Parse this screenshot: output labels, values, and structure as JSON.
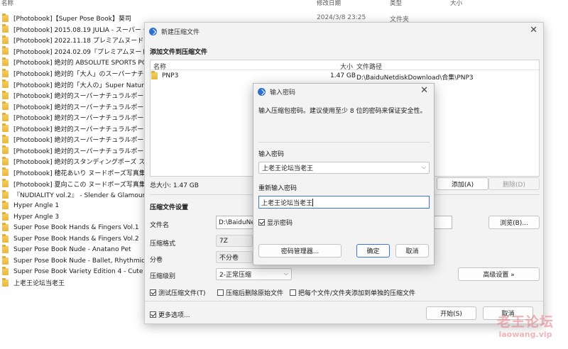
{
  "explorer": {
    "columns": {
      "name": "名称",
      "modified": "修改日期",
      "type": "类型",
      "size": "大小"
    },
    "first_row_date": "2024/3/8 23:25",
    "first_row_type": "文件夹",
    "items": [
      "[Photobook]【Super Pose Book】葵司",
      "[Photobook] 2015.08.19 JULIA - スーパー・ポ",
      "[Photobook] 2022.11.18 プレミアムヌードポー",
      "[Photobook] 2024.02.09『プレミアムヌードポ",
      "[Photobook] 絶対的 ABSOLUTE SPORTS POSES",
      "[Photobook] 絶対的「大人」のスーパーナチュ",
      "[Photobook] 絶対的「大人の」Super Natural P",
      "[Photobook] 絶対的スーパーナチュラルポーズ",
      "[Photobook] 絶対的スーパーナチュラルポーズ",
      "[Photobook] 絶対的スーパーナチュラルポーズ",
      "[Photobook] 絶対的スーパーナチュラルポーズ",
      "[Photobook] 絶対的スーパーナチュラルポーズ",
      "[Photobook] 絶対的スーパーナチュラルポーズ",
      "[Photobook] 絶対的スタンディングポーズ ス",
      "[Photobook] 穂花あいり ヌードポーズ写真集 絶",
      "[Photobook] 夏向ここの ヌードポーズ写真集 絶",
      "『NUDIALITY vol.2』 - Slender & Glamour SP",
      "Hyper Angle 1",
      "Hyper Angle 3",
      "Super Pose Book Hands & Fingers Vol.1",
      "Super Pose Book Hands & Fingers Vol.2",
      "Super Pose Book Nude - Anatano Pet",
      "Super Pose Book Nude - Ballet, Rhythmic Gym",
      "Super Pose Book Variety Edition 4 - Cute",
      "上老王论坛当老王"
    ]
  },
  "archive_dialog": {
    "title": "新建压缩文件",
    "add_section_label": "添加文件到压缩文件",
    "file_list": {
      "col_name": "名称",
      "col_size": "大小",
      "col_path": "文件路径",
      "rows": [
        {
          "name": "PNP3",
          "size": "1.47 GB",
          "path": "D:\\BaiduNetdiskDownload\\合集\\PNP3"
        }
      ]
    },
    "total_size": "总大小: 1.47 GB",
    "add_button": "添加(A)",
    "delete_button": "删除(D)",
    "settings_label": "压缩文件设置",
    "filename_label": "文件名",
    "filename_value": "D:\\BaiduNet",
    "browse_button": "浏览(B)...",
    "format_label": "压缩格式",
    "format_value": "7Z",
    "split_label": "分卷",
    "split_value": "不分卷",
    "level_label": "压缩级别",
    "level_value": "2-正常压缩",
    "advanced_button": "高级设置 »",
    "checkbox_test": "测试压缩文件(T)",
    "checkbox_delete": "压缩后删除原始文件",
    "checkbox_separate": "把每个文件/文件夹添加到单独的压缩文件",
    "more_options": "更多选项...",
    "start_button": "开始(S)",
    "cancel_button": "取消"
  },
  "password_dialog": {
    "title": "输入密码",
    "hint": "输入压缩包密码。建议使用至少 8 位的密码来保证安全性。",
    "enter_label": "输入密码",
    "enter_value": "上老王论坛当老王",
    "reenter_label": "重新输入密码",
    "reenter_value": "上老王论坛当老王",
    "show_password": "显示密码",
    "manager_button": "密码管理器...",
    "ok_button": "确定",
    "cancel_button": "取消"
  },
  "watermark": {
    "top": "老王论坛",
    "bottom": "laowang.vip"
  }
}
